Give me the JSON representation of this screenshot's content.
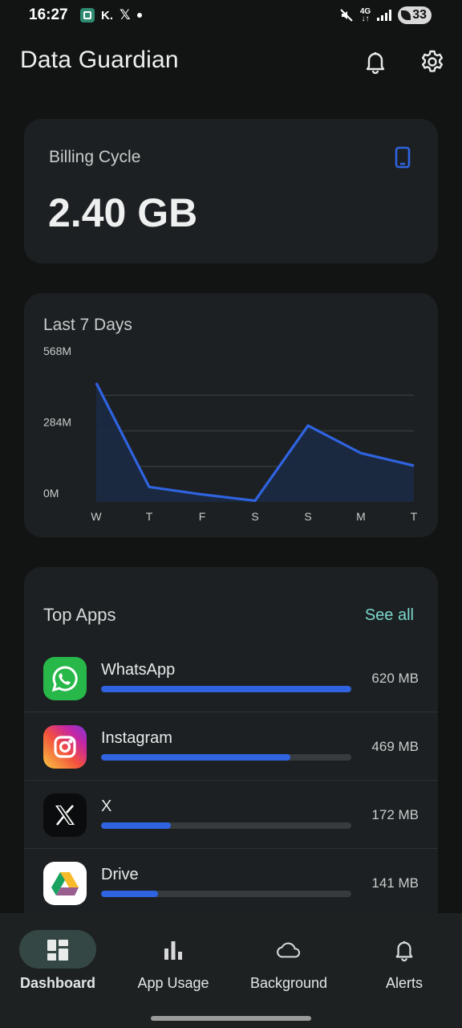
{
  "status_bar": {
    "time": "16:27",
    "left_icons": [
      "app-notification-icon",
      "kite-icon",
      "x-icon",
      "dot-icon"
    ],
    "k_label": "K.",
    "x_label": "𝕏",
    "network": "4G",
    "battery": "33",
    "right_icons": [
      "mute-icon",
      "signal-icon",
      "battery-saver-icon"
    ]
  },
  "header": {
    "title": "Data Guardian",
    "icons": [
      "bell-icon",
      "gear-icon"
    ]
  },
  "billing": {
    "label": "Billing Cycle",
    "value": "2.40 GB",
    "icon": "phone-icon",
    "accent": "#2f63e0"
  },
  "week": {
    "title": "Last 7 Days"
  },
  "chart_data": {
    "type": "area",
    "title": "Last 7 Days",
    "categories": [
      "W",
      "T",
      "F",
      "S",
      "S",
      "M",
      "T"
    ],
    "values": [
      475,
      60,
      30,
      5,
      305,
      195,
      145
    ],
    "y_unit": "M",
    "yticks": [
      "568M",
      "284M",
      "0M"
    ],
    "ylim": [
      0,
      568
    ],
    "grid": true,
    "color": "#2f63e0"
  },
  "top_apps": {
    "title": "Top Apps",
    "see_all": "See all",
    "max_mb": 620,
    "items": [
      {
        "name": "WhatsApp",
        "size": "620 MB",
        "mb": 620,
        "icon": "whatsapp-icon"
      },
      {
        "name": "Instagram",
        "size": "469 MB",
        "mb": 469,
        "icon": "instagram-icon"
      },
      {
        "name": "X",
        "size": "172 MB",
        "mb": 172,
        "icon": "x-logo-icon"
      },
      {
        "name": "Drive",
        "size": "141 MB",
        "mb": 141,
        "icon": "drive-icon"
      }
    ]
  },
  "nav": {
    "items": [
      {
        "label": "Dashboard",
        "icon": "dashboard-icon",
        "active": true
      },
      {
        "label": "App Usage",
        "icon": "bar-chart-icon",
        "active": false
      },
      {
        "label": "Background",
        "icon": "cloud-icon",
        "active": false
      },
      {
        "label": "Alerts",
        "icon": "bell-icon",
        "active": false
      }
    ]
  }
}
